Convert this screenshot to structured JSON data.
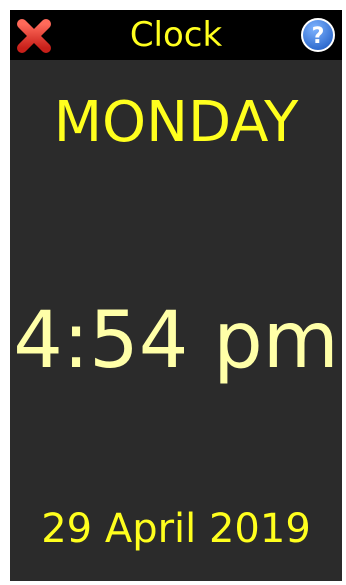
{
  "app": {
    "title": "Clock"
  },
  "toolbar": {
    "close_icon": "close-x-icon",
    "help_icon": "help-question-icon",
    "close_color": "#e8352b",
    "help_color": "#2a6fd6"
  },
  "clock": {
    "day": "MONDAY",
    "time": "4:54 pm",
    "date": "29 April 2019"
  },
  "colors": {
    "background": "#2b2b2b",
    "titlebar": "#000000",
    "accent_yellow": "#ffff1e",
    "time_color": "#ffffa8"
  }
}
